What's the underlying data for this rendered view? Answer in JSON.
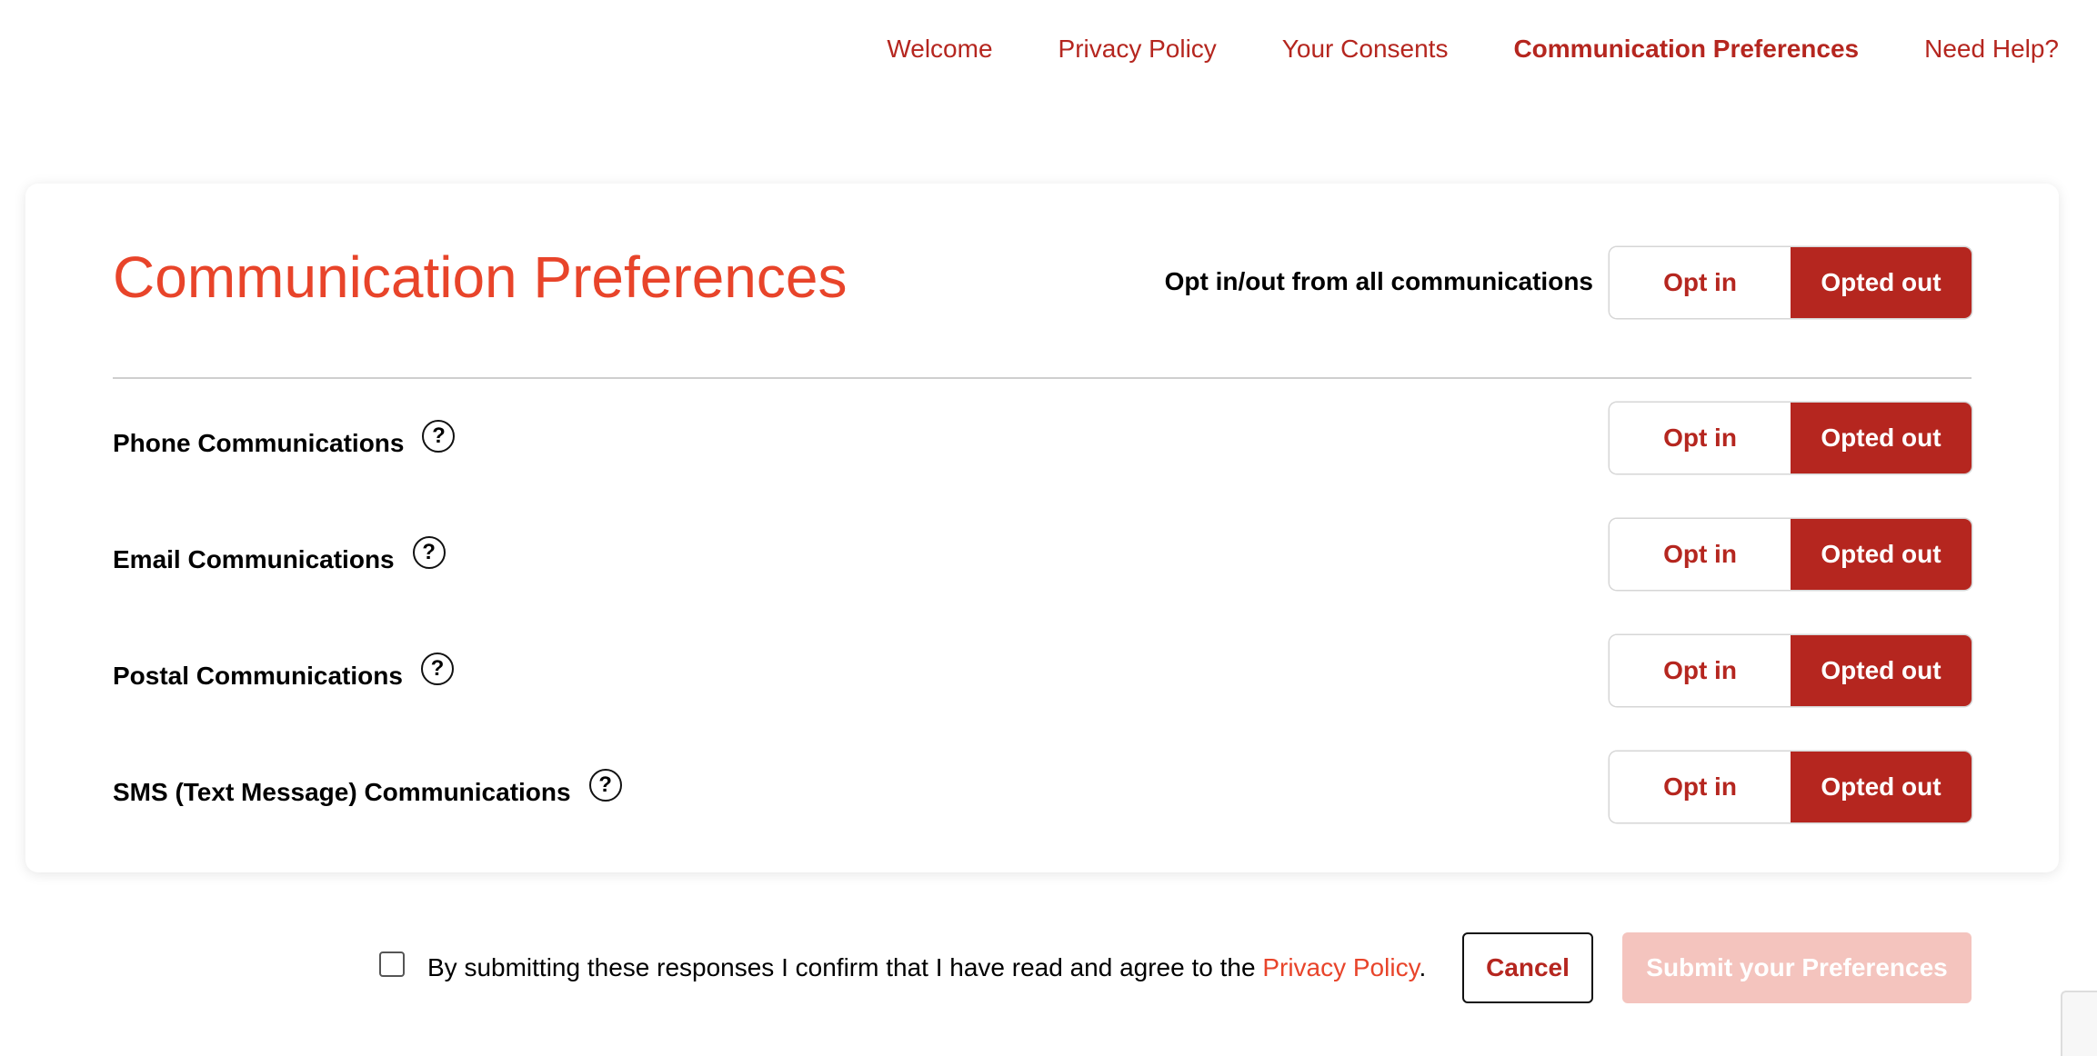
{
  "nav": {
    "items": [
      {
        "label": "Welcome"
      },
      {
        "label": "Privacy Policy"
      },
      {
        "label": "Your Consents"
      },
      {
        "label": "Communication Preferences",
        "active": true
      },
      {
        "label": "Need Help?"
      }
    ]
  },
  "card": {
    "title": "Communication Preferences",
    "all_label": "Opt in/out from all communications",
    "opt_in_label": "Opt in",
    "opted_out_label": "Opted out",
    "rows": [
      {
        "label": "Phone Communications"
      },
      {
        "label": "Email Communications"
      },
      {
        "label": "Postal Communications"
      },
      {
        "label": "SMS (Text Message) Communications"
      }
    ],
    "help_glyph": "?"
  },
  "footer": {
    "agree_text": "By submitting these responses I confirm that I have read and agree to the ",
    "agree_link": "Privacy Policy",
    "agree_end": ".",
    "checkbox_checked": false,
    "cancel_label": "Cancel",
    "submit_label": "Submit your Preferences"
  },
  "colors": {
    "accent": "#b5261f",
    "title": "#e8442a",
    "submit_disabled": "#f4c4be"
  }
}
